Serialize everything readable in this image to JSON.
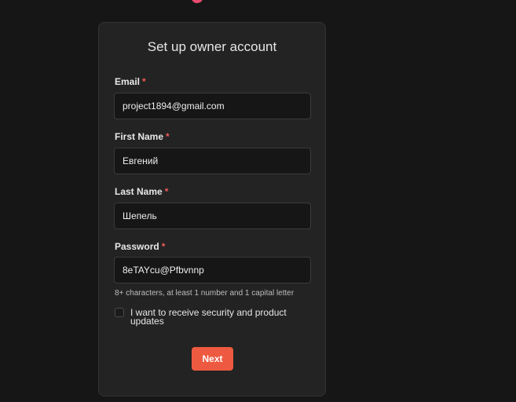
{
  "brand": {
    "logo_color": "#ea4b71"
  },
  "card": {
    "title": "Set up owner account",
    "fields": [
      {
        "label": "Email",
        "value": "project1894@gmail.com",
        "required": "*"
      },
      {
        "label": "First Name",
        "value": "Евгений",
        "required": "*"
      },
      {
        "label": "Last Name",
        "value": "Шепель",
        "required": "*"
      },
      {
        "label": "Password",
        "value": "8eTAYcu@Pfbvnnp",
        "required": "*"
      }
    ],
    "password_hint": "8+ characters, at least 1 number and 1 capital letter",
    "checkbox_label": "I want to receive security and product updates",
    "checkbox_checked": false,
    "next_label": "Next"
  },
  "colors": {
    "background": "#161616",
    "card": "#232323",
    "accent": "#ee5a41",
    "required": "#f05a5a"
  }
}
